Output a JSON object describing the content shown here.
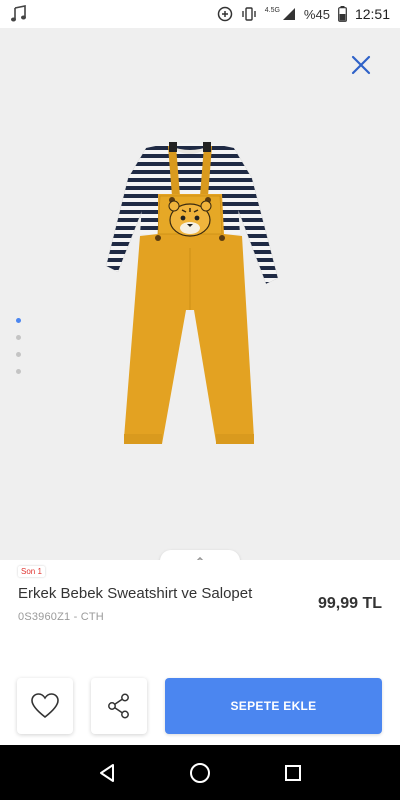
{
  "status_bar": {
    "battery_percent": "%45",
    "time": "12:51",
    "network": "4.5G",
    "icons": [
      "music-note-icon",
      "data-saver-icon",
      "vibrate-icon",
      "signal-icon",
      "battery-icon"
    ]
  },
  "gallery": {
    "image_count": 4,
    "active_index": 0,
    "image_icon": "baby-overalls-image"
  },
  "product": {
    "badge": "Son 1",
    "title": "Erkek Bebek Sweatshirt ve Salopet",
    "sku": "0S3960Z1 - CTH",
    "price": "99,99 TL"
  },
  "actions": {
    "add_to_cart": "SEPETE EKLE",
    "favorite_icon": "heart-icon",
    "share_icon": "share-icon"
  },
  "colors": {
    "accent": "#4b86f0",
    "badge": "#e0332f",
    "overalls": "#e3a222"
  }
}
